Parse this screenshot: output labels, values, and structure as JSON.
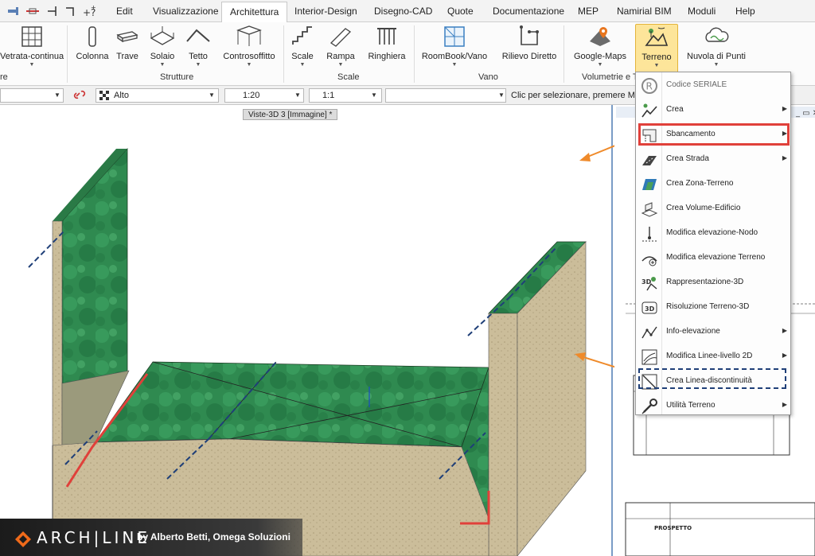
{
  "menu": {
    "tabs": [
      "Edit",
      "Visualizzazione",
      "Architettura",
      "Interior-Design",
      "Disegno-CAD",
      "Quote",
      "Documentazione",
      "MEP",
      "Namirial BIM",
      "Moduli",
      "Help"
    ],
    "active_tab": "Architettura",
    "qa_icons": [
      "wall-tool-icon",
      "line-tool-icon",
      "cursor-tool-icon",
      "snap-tool-icon",
      "help-plus-icon"
    ]
  },
  "ribbon": {
    "buttons": {
      "vetrata": "Vetrata-continua",
      "colonna": "Colonna",
      "trave": "Trave",
      "solaio": "Solaio",
      "tetto": "Tetto",
      "controsoffitto": "Controsoffitto",
      "scale": "Scale",
      "rampa": "Rampa",
      "ringhiera": "Ringhiera",
      "roombook": "RoomBook/Vano",
      "rilievo": "Rilievo Diretto",
      "googlemaps": "Google-Maps",
      "terreno": "Terreno",
      "nuvola": "Nuvola di Punti"
    },
    "groups": {
      "left_partial": "re",
      "strutture": "Strutture",
      "scale": "Scale",
      "vano": "Vano",
      "volumetrie": "Volumetrie e T"
    }
  },
  "toolbar": {
    "hatch_value": "Alto",
    "scale_value": "1:20",
    "ratio_value": "1:1",
    "text_field": "",
    "hint": "Clic per selezionare, premere Maiusc"
  },
  "viewport": {
    "tab_label": "Viste-3D 3 [Immagine] *"
  },
  "dropdown": {
    "items": [
      {
        "label": "Codice SERIALE",
        "icon": "registered-icon",
        "submenu": false
      },
      {
        "label": "Crea",
        "icon": "terrain-create-icon",
        "submenu": true
      },
      {
        "label": "Sbancamento",
        "icon": "excavation-icon",
        "submenu": true
      },
      {
        "label": "Crea Strada",
        "icon": "road-icon",
        "submenu": true
      },
      {
        "label": "Crea Zona-Terreno",
        "icon": "terrain-zone-icon",
        "submenu": false
      },
      {
        "label": "Crea Volume-Edificio",
        "icon": "building-volume-icon",
        "submenu": false
      },
      {
        "label": "Modifica elevazione-Nodo",
        "icon": "node-elevation-icon",
        "submenu": false
      },
      {
        "label": "Modifica elevazione Terreno",
        "icon": "terrain-elevation-icon",
        "submenu": false
      },
      {
        "label": "Rappresentazione-3D",
        "icon": "representation-3d-icon",
        "submenu": false
      },
      {
        "label": "Risoluzione Terreno-3D",
        "icon": "resolution-3d-icon",
        "submenu": false
      },
      {
        "label": "Info-elevazione",
        "icon": "info-elevation-icon",
        "submenu": true
      },
      {
        "label": "Modifica Linee-livello 2D",
        "icon": "contour-lines-icon",
        "submenu": true
      },
      {
        "label": "Crea Linea-discontinuità",
        "icon": "discontinuity-line-icon",
        "submenu": false
      },
      {
        "label": "Utilità Terreno",
        "icon": "terrain-utility-icon",
        "submenu": true
      }
    ]
  },
  "right_panel": {
    "sheet_label": "PROSPETTO"
  },
  "branding": {
    "logo": "ARCH|LINE",
    "byline": "by Alberto Betti, Omega Soluzioni"
  },
  "colors": {
    "highlight_red": "#e0403a",
    "highlight_blue_dashed": "#1f3f78",
    "arrow_orange": "#ef8a2a",
    "terrain_green": "#2f8a50",
    "soil_beige": "#cbbd9a",
    "active_button": "#fde59a"
  }
}
